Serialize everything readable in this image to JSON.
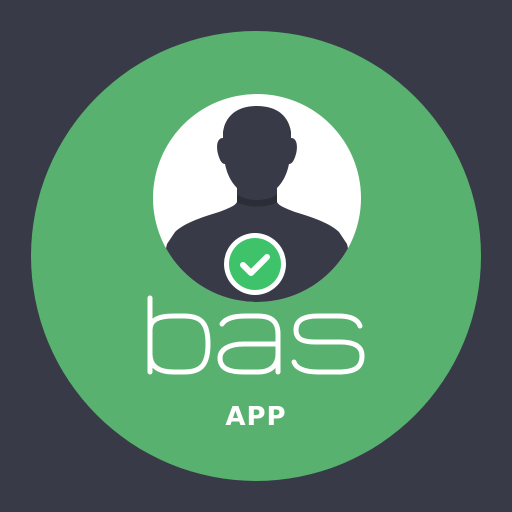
{
  "app_icon": {
    "wordmark": "bas",
    "label": "APP",
    "icons": {
      "avatar": "user-silhouette-icon",
      "badge": "checkmark-icon"
    },
    "colors": {
      "background": "#383b47",
      "disc": "#58b16e",
      "avatar_bg": "#ffffff",
      "silhouette": "#383b47",
      "badge": "#3ec36b",
      "text": "#ffffff"
    }
  }
}
